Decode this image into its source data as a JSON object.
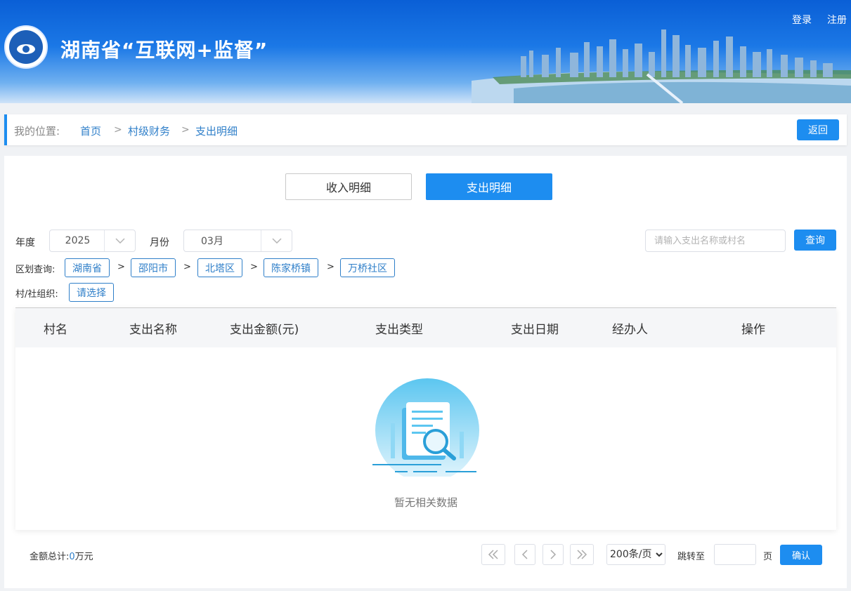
{
  "header": {
    "title": "湖南省“互联网+监督”",
    "login": "登录",
    "register": "注册"
  },
  "breadcrumb": {
    "location_label": "我的位置:",
    "items": [
      "首页",
      "村级财务",
      "支出明细"
    ],
    "separator": ">",
    "back": "返回"
  },
  "tabs": [
    {
      "label": "收入明细",
      "active": false
    },
    {
      "label": "支出明细",
      "active": true
    }
  ],
  "filters": {
    "year_label": "年度",
    "year_value": "2025",
    "month_label": "月份",
    "month_value": "03月",
    "search_placeholder": "请输入支出名称或村名",
    "query_button": "查询",
    "region_label": "区划查询:",
    "regions": [
      "湖南省",
      "邵阳市",
      "北塔区",
      "陈家桥镇",
      "万桥社区"
    ],
    "region_separator": ">",
    "org_label": "村/社组织:",
    "org_select": "请选择"
  },
  "table": {
    "columns": [
      "村名",
      "支出名称",
      "支出金额(元)",
      "支出类型",
      "支出日期",
      "经办人",
      "操作"
    ],
    "rows": [],
    "empty_text": "暂无相关数据"
  },
  "footer": {
    "total_label": "金额总计:",
    "total_value": "0",
    "total_unit": "万元",
    "page_size": "200条/页",
    "jump_label": "跳转至",
    "page_unit": "页",
    "confirm": "确认"
  },
  "colors": {
    "primary": "#1d8df0",
    "link": "#2f7fc9",
    "header_top": "#0a5fd6"
  }
}
